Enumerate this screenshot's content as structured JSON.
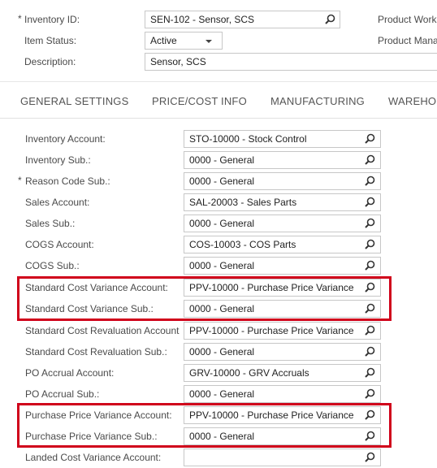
{
  "header": {
    "inventory_id": {
      "label": "Inventory ID:",
      "required": "*",
      "value": "SEN-102 - Sensor, SCS"
    },
    "item_status": {
      "label": "Item Status:",
      "value": "Active"
    },
    "description": {
      "label": "Description:",
      "value": "Sensor, SCS"
    },
    "right_labels": [
      "Product Work",
      "Product Mana"
    ]
  },
  "tabs": [
    {
      "label": "GENERAL SETTINGS"
    },
    {
      "label": "PRICE/COST INFO"
    },
    {
      "label": "MANUFACTURING"
    },
    {
      "label": "WAREHOU"
    }
  ],
  "rows": [
    {
      "label": "Inventory Account:",
      "required": "",
      "value": "STO-10000 - Stock Control"
    },
    {
      "label": "Inventory Sub.:",
      "required": "",
      "value": "0000 - General"
    },
    {
      "label": "Reason Code Sub.:",
      "required": "*",
      "value": "0000 - General"
    },
    {
      "label": "Sales Account:",
      "required": "",
      "value": "SAL-20003 - Sales Parts"
    },
    {
      "label": "Sales Sub.:",
      "required": "",
      "value": "0000 - General"
    },
    {
      "label": "COGS Account:",
      "required": "",
      "value": "COS-10003 - COS Parts"
    },
    {
      "label": "COGS Sub.:",
      "required": "",
      "value": "0000 - General"
    },
    {
      "label": "Standard Cost Variance Account:",
      "required": "",
      "value": "PPV-10000 - Purchase Price Variance"
    },
    {
      "label": "Standard Cost Variance Sub.:",
      "required": "",
      "value": "0000 - General"
    },
    {
      "label": "Standard Cost Revaluation Account:",
      "required": "",
      "value": "PPV-10000 - Purchase Price Variance"
    },
    {
      "label": "Standard Cost Revaluation Sub.:",
      "required": "",
      "value": "0000 - General"
    },
    {
      "label": "PO Accrual Account:",
      "required": "",
      "value": "GRV-10000 - GRV Accruals"
    },
    {
      "label": "PO Accrual Sub.:",
      "required": "",
      "value": "0000 - General"
    },
    {
      "label": "Purchase Price Variance Account:",
      "required": "",
      "value": "PPV-10000 - Purchase Price Variance"
    },
    {
      "label": "Purchase Price Variance Sub.:",
      "required": "",
      "value": "0000 - General"
    },
    {
      "label": "Landed Cost Variance Account:",
      "required": "",
      "value": ""
    }
  ],
  "colors": {
    "highlight": "#d0021b",
    "border": "#c7c7c7",
    "label": "#4a4a4a"
  },
  "icons": {
    "lookup": "magnifier-icon",
    "dropdown": "chevron-down-icon"
  }
}
